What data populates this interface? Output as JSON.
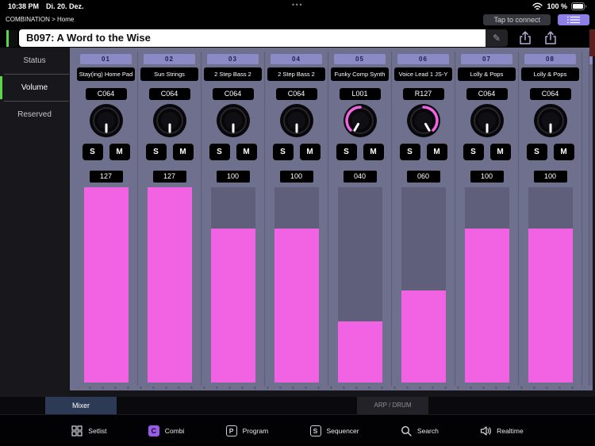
{
  "status_bar": {
    "time": "10:38 PM",
    "date": "Di. 20. Dez.",
    "handle": "•••",
    "battery_percent": "100 %"
  },
  "nav": {
    "breadcrumb": "COMBINATION > Home",
    "connect_button": "Tap to connect"
  },
  "title_bar": {
    "title": "B097: A Word to the Wise",
    "edit_icon": "✎"
  },
  "sidebar": {
    "items": [
      {
        "label": "Status",
        "active": false
      },
      {
        "label": "Volume",
        "active": true
      },
      {
        "label": "Reserved",
        "active": false
      }
    ]
  },
  "mixer": {
    "solo_label": "S",
    "mute_label": "M",
    "max_level": 127,
    "channels": [
      {
        "num": "01",
        "name": "Stay(ing) Home Pad",
        "pan": "C064",
        "volume": "127",
        "level": 127,
        "knob_angle_deg": 180,
        "knob_arc": "none"
      },
      {
        "num": "02",
        "name": "Sun Strings",
        "pan": "C064",
        "volume": "127",
        "level": 127,
        "knob_angle_deg": 180,
        "knob_arc": "none"
      },
      {
        "num": "03",
        "name": "2 Step Bass 2",
        "pan": "C064",
        "volume": "100",
        "level": 100,
        "knob_angle_deg": 180,
        "knob_arc": "none"
      },
      {
        "num": "04",
        "name": "2 Step Bass 2",
        "pan": "C064",
        "volume": "100",
        "level": 100,
        "knob_angle_deg": 180,
        "knob_arc": "none"
      },
      {
        "num": "05",
        "name": "Funky Comp Synth",
        "pan": "L001",
        "volume": "040",
        "level": 40,
        "knob_angle_deg": 210,
        "knob_arc": "left"
      },
      {
        "num": "06",
        "name": "Voice Lead 1 JS-Y",
        "pan": "R127",
        "volume": "060",
        "level": 60,
        "knob_angle_deg": 150,
        "knob_arc": "right"
      },
      {
        "num": "07",
        "name": "Lolly & Pops",
        "pan": "C064",
        "volume": "100",
        "level": 100,
        "knob_angle_deg": 180,
        "knob_arc": "none"
      },
      {
        "num": "08",
        "name": "Lolly & Pops",
        "pan": "C064",
        "volume": "100",
        "level": 100,
        "knob_angle_deg": 180,
        "knob_arc": "none"
      }
    ]
  },
  "tabs": {
    "mixer": "Mixer",
    "arp_drum": "ARP / DRUM"
  },
  "toolbar": {
    "items": [
      {
        "label": "Setlist",
        "active": false
      },
      {
        "label": "Combi",
        "active": true,
        "icon_letter": "C"
      },
      {
        "label": "Program",
        "active": false,
        "icon_letter": "P"
      },
      {
        "label": "Sequencer",
        "active": false,
        "icon_letter": "S"
      },
      {
        "label": "Search",
        "active": false
      },
      {
        "label": "Realtime",
        "active": false
      }
    ]
  },
  "colors": {
    "fader_pink": "#f163e3",
    "accent_green": "#5bd648",
    "combi_purple": "#9a5ce8",
    "header_purple": "#8c8ac6"
  }
}
